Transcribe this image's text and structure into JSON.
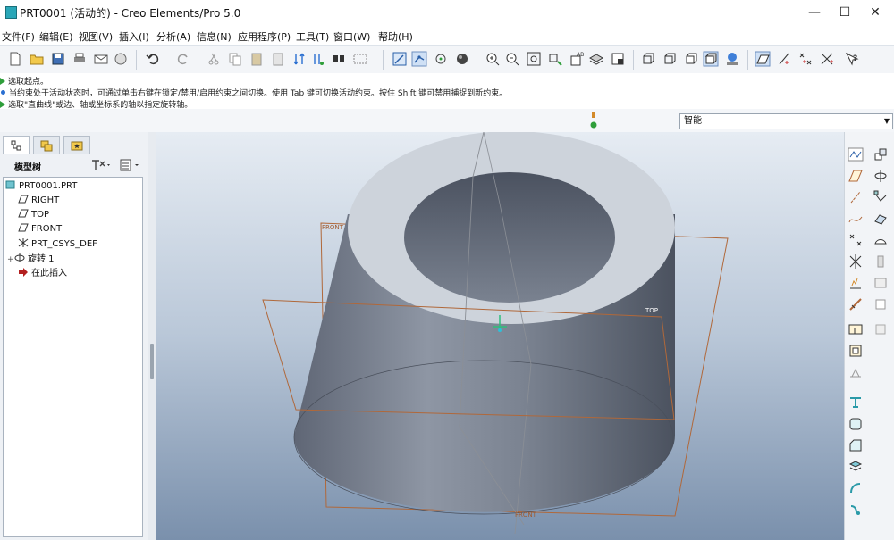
{
  "window": {
    "title": "PRT0001 (活动的) - Creo Elements/Pro 5.0",
    "controls": {
      "minimize": "—",
      "maximize": "☐",
      "close": "✕"
    }
  },
  "menu": [
    "文件(F)",
    "编辑(E)",
    "视图(V)",
    "插入(I)",
    "分析(A)",
    "信息(N)",
    "应用程序(P)",
    "工具(T)",
    "窗口(W)",
    "帮助(H)"
  ],
  "messages": [
    "选取起点。",
    "当约束处于活动状态时，可通过单击右键在锁定/禁用/启用约束之间切换。使用 Tab 键可切换活动约束。按住 Shift 键可禁用捕捉到新约束。",
    "选取\"直曲线\"或边、轴或坐标系的轴以指定旋转轴。"
  ],
  "filter": {
    "selected": "智能"
  },
  "panel": {
    "title": "模型树"
  },
  "model_tree": [
    {
      "label": "PRT0001.PRT",
      "icon": "part-icon"
    },
    {
      "label": "RIGHT",
      "icon": "datum-plane-icon"
    },
    {
      "label": "TOP",
      "icon": "datum-plane-icon"
    },
    {
      "label": "FRONT",
      "icon": "datum-plane-icon"
    },
    {
      "label": "PRT_CSYS_DEF",
      "icon": "csys-icon"
    },
    {
      "label": "旋转 1",
      "icon": "revolve-icon"
    },
    {
      "label": "在此插入",
      "icon": "insert-here-arrow-icon"
    }
  ],
  "viewport": {
    "plane_labels": {
      "front_top": "FRONT",
      "top": "TOP",
      "front_bottom": "FRONT"
    }
  },
  "colors": {
    "datum_plane": "#b0683a",
    "model": "#7d8593",
    "model_top": "#cfd5dd",
    "accent_green": "#2e9e3a"
  }
}
